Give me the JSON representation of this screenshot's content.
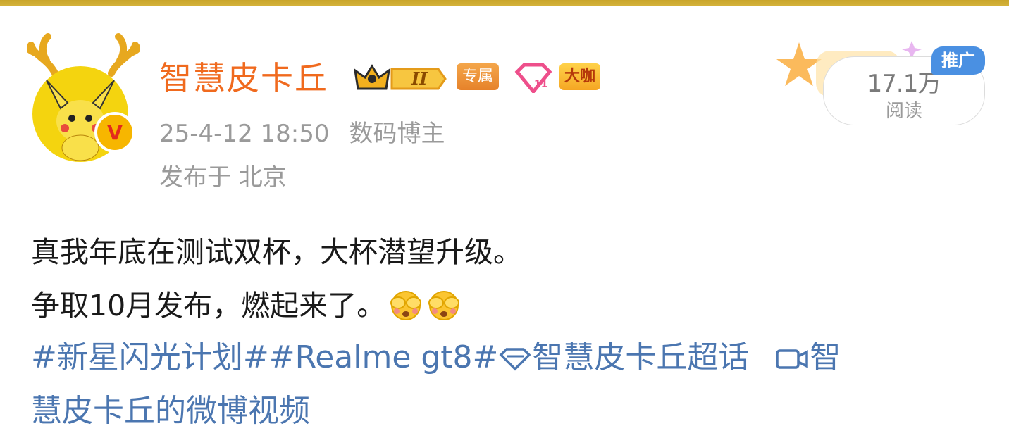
{
  "post": {
    "author": {
      "name": "智慧皮卡丘",
      "level_badge": "II",
      "badges": [
        "专属",
        "大咖"
      ],
      "verified_mark": "V"
    },
    "time": "25-4-12 18:50",
    "category": "数码博主",
    "location": "发布于 北京",
    "stats": {
      "read_count": "17.1万",
      "read_label": "阅读",
      "promo_label": "推广"
    },
    "content": {
      "line1": "真我年底在测试双杯，大杯潜望升级。",
      "line2": "争取10月发布，燃起来了。"
    },
    "tags": {
      "tag1": "#新星闪光计划#",
      "tag2": "#Realme gt8#",
      "super_topic": "智慧皮卡丘超话",
      "video_link_part1": "智",
      "video_link_part2": "慧皮卡丘的微博视频"
    },
    "icons": {
      "crown": "crown-icon",
      "gem": "vip-gem-icon",
      "emoji": "cover-face-emoji-icon",
      "diamond": "diamond-icon",
      "video": "video-camera-icon"
    },
    "colors": {
      "name": "#f06a1e",
      "meta": "#9a9a9a",
      "link": "#4b76b0",
      "promo": "#4a90e2"
    }
  }
}
